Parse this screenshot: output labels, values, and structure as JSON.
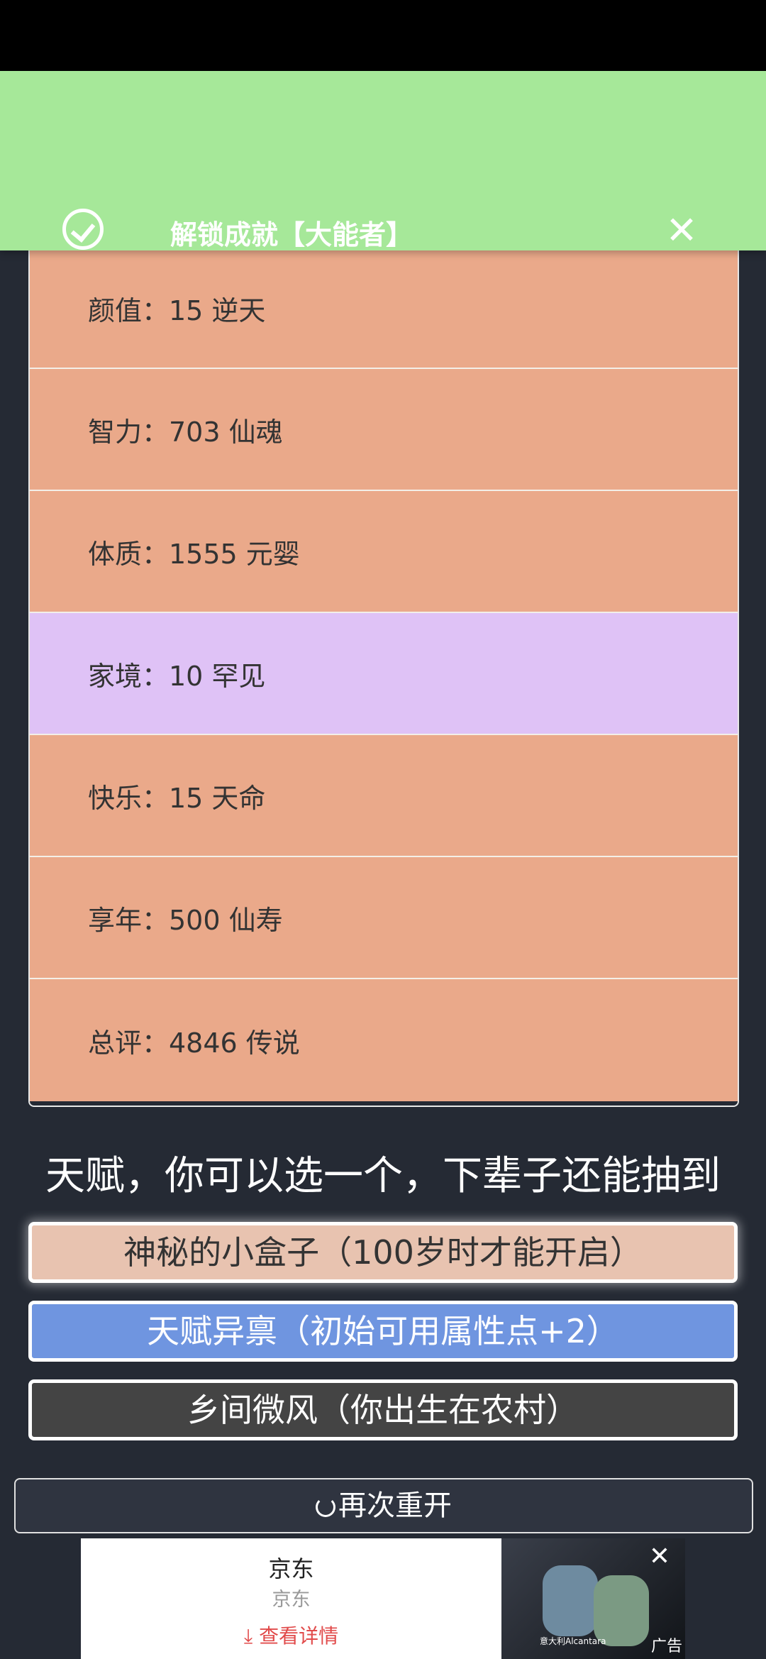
{
  "toast": {
    "title": "解锁成就【大能者】",
    "close_glyph": "✕"
  },
  "stats": [
    {
      "label": "颜值：15 逆天",
      "color": "#eaa98a"
    },
    {
      "label": "智力：703 仙魂",
      "color": "#eaa98a"
    },
    {
      "label": "体质：1555 元婴",
      "color": "#eaa98a"
    },
    {
      "label": "家境：10 罕见",
      "color": "#dfc2f6"
    },
    {
      "label": "快乐：15 天命",
      "color": "#eaa98a"
    },
    {
      "label": "享年：500 仙寿",
      "color": "#eaa98a"
    },
    {
      "label": "总评：4846 传说",
      "color": "#eaa98a"
    }
  ],
  "talent_heading": "天赋，你可以选一个，下辈子还能抽到",
  "talents": [
    {
      "label": "神秘的小盒子（100岁时才能开启）",
      "color": "#e8c3b0"
    },
    {
      "label": "天赋异禀（初始可用属性点+2）",
      "color": "#6f95e0"
    },
    {
      "label": "乡间微风（你出生在农村）",
      "color": "#444444"
    }
  ],
  "restart_label": "再次重开",
  "ad": {
    "brand": "京东",
    "sub": "京东",
    "cta": "⤓ 查看详情",
    "fabric": "意大利Alcantara",
    "label": "广告",
    "close_glyph": "✕"
  }
}
